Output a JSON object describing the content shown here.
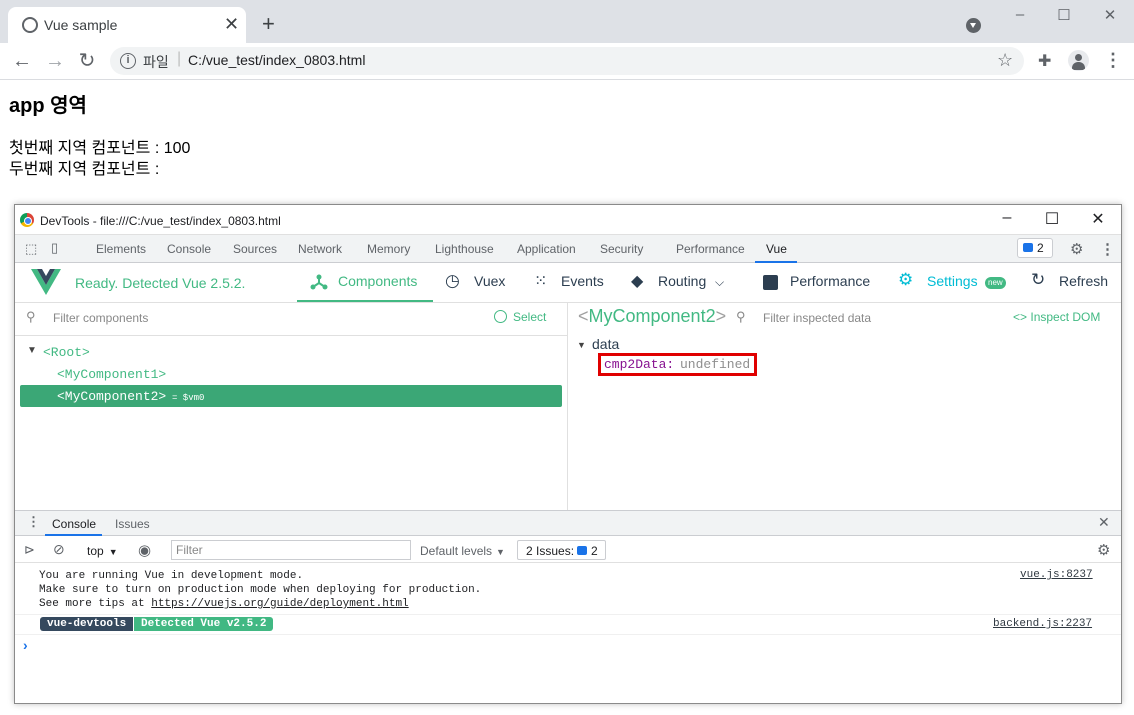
{
  "browser": {
    "tab_title": "Vue sample",
    "url_scheme_label": "파일",
    "url": "C:/vue_test/index_0803.html"
  },
  "page": {
    "heading": "app 영역",
    "line1": "첫번째 지역 컴포넌트 : 100",
    "line2": "두번째 지역 컴포넌트 :"
  },
  "devtools": {
    "title": "DevTools - file:///C:/vue_test/index_0803.html",
    "tabs": [
      "Elements",
      "Console",
      "Sources",
      "Network",
      "Memory",
      "Lighthouse",
      "Application",
      "Security",
      "Performance",
      "Vue"
    ],
    "issues_count": "2",
    "vue": {
      "ready_text": "Ready. Detected Vue 2.5.2.",
      "nav": {
        "components": "Components",
        "vuex": "Vuex",
        "events": "Events",
        "routing": "Routing",
        "performance": "Performance",
        "settings": "Settings",
        "settings_badge": "new",
        "refresh": "Refresh"
      },
      "filter_components_placeholder": "Filter components",
      "select_label": "Select",
      "tree": {
        "root": "<Root>",
        "child1": "<MyComponent1>",
        "child2": "<MyComponent2>",
        "child2_vm": "= $vm0"
      },
      "inspected": {
        "name": "MyComponent2",
        "filter_placeholder": "Filter inspected data",
        "inspect_dom_label": "Inspect DOM",
        "section": "data",
        "key": "cmp2Data",
        "value": "undefined"
      }
    },
    "drawer": {
      "tabs": [
        "Console",
        "Issues"
      ],
      "context": "top",
      "filter_placeholder": "Filter",
      "levels": "Default levels",
      "issues_label": "2 Issues:",
      "issues_count": "2",
      "messages": {
        "m1_line1": "You are running Vue in development mode.",
        "m1_line2": "Make sure to turn on production mode when deploying for production.",
        "m1_line3_prefix": "See more tips at ",
        "m1_link": "https://vuejs.org/guide/deployment.html",
        "m1_source": "vue.js:8237",
        "badge_left": "vue-devtools",
        "badge_right": "Detected Vue v2.5.2",
        "m2_source": "backend.js:2237"
      }
    }
  }
}
